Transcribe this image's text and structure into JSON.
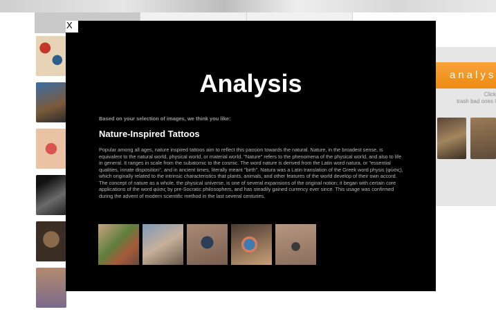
{
  "close_label": "X",
  "modal": {
    "title": "Analysis",
    "intro": "Based on your selection of images, we think you like:",
    "subtitle": "Nature-Inspired Tattoos",
    "description": "Popular among all ages, nature inspired tattoos aim to reflect this passion towards the natural. Nature, in the broadest sense, is equivalent to the natural world, physical world, or material world. \"Nature\" refers to the phenomena of the physical world, and also to life in general. It ranges in scale from the subatomic to the cosmic. The word nature is derived from the Latin word natura, or \"essential qualities, innate disposition\", and in ancient times, literally meant \"birth\". Natura was a Latin translation of the Greek word physis (φύσις), which originally related to the intrinsic characteristics that plants, animals, and other features of the world develop of their own accord. The concept of nature as a whole, the physical universe, is one of several expansions of the original notion; it began with certain core applications of the word φύσις by pre-Socratic philosophers, and has steadily gained currency ever since. This usage was confirmed during the advent of modern scientific method in the last several centuries."
  },
  "right_panel": {
    "banner": "analys",
    "hint_line1": "Click",
    "hint_line2": "trash bad ones i"
  },
  "colors": {
    "overlay": "#000000",
    "banner": "#f0901a"
  }
}
